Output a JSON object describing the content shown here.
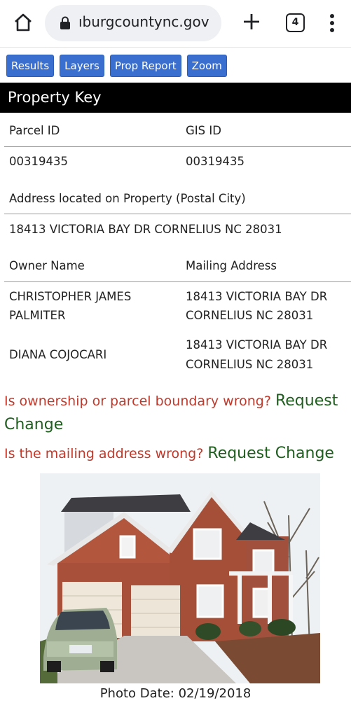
{
  "browser": {
    "url_text": "ıburgcountync.gov",
    "tab_count": "4",
    "home_icon": "home-icon",
    "lock_icon": "lock-icon",
    "new_tab_icon": "plus-icon",
    "menu_icon": "more-vertical-icon"
  },
  "toolbar": {
    "buttons": [
      {
        "label": "Results"
      },
      {
        "label": "Layers"
      },
      {
        "label": "Prop Report"
      },
      {
        "label": "Zoom"
      }
    ],
    "button_color": "#3a6fd0"
  },
  "property_key": {
    "title": "Property Key",
    "parcel_id_label": "Parcel ID",
    "gis_id_label": "GIS ID",
    "parcel_id": "00319435",
    "gis_id": "00319435",
    "address_label": "Address located on Property (Postal City)",
    "address": "18413 VICTORIA BAY DR CORNELIUS NC 28031",
    "owner_name_label": "Owner Name",
    "mailing_address_label": "Mailing Address",
    "owners": [
      {
        "name_line1": "CHRISTOPHER JAMES",
        "name_line2": "PALMITER",
        "mail_line1": "18413 VICTORIA BAY DR",
        "mail_line2": "CORNELIUS NC 28031"
      },
      {
        "name_line1": "DIANA COJOCARI",
        "name_line2": "",
        "mail_line1": "18413 VICTORIA BAY DR",
        "mail_line2": "CORNELIUS NC 28031"
      }
    ]
  },
  "alerts": {
    "ownership_question": "Is ownership or parcel boundary wrong?",
    "ownership_link_part1": "Request",
    "ownership_link_part2": "Change",
    "mailing_question": "Is the mailing address wrong?",
    "mailing_link": "Request Change",
    "question_color": "#c0392b",
    "link_color": "#1f5e1f"
  },
  "photo": {
    "date_label": "Photo Date: 02/19/2018"
  }
}
